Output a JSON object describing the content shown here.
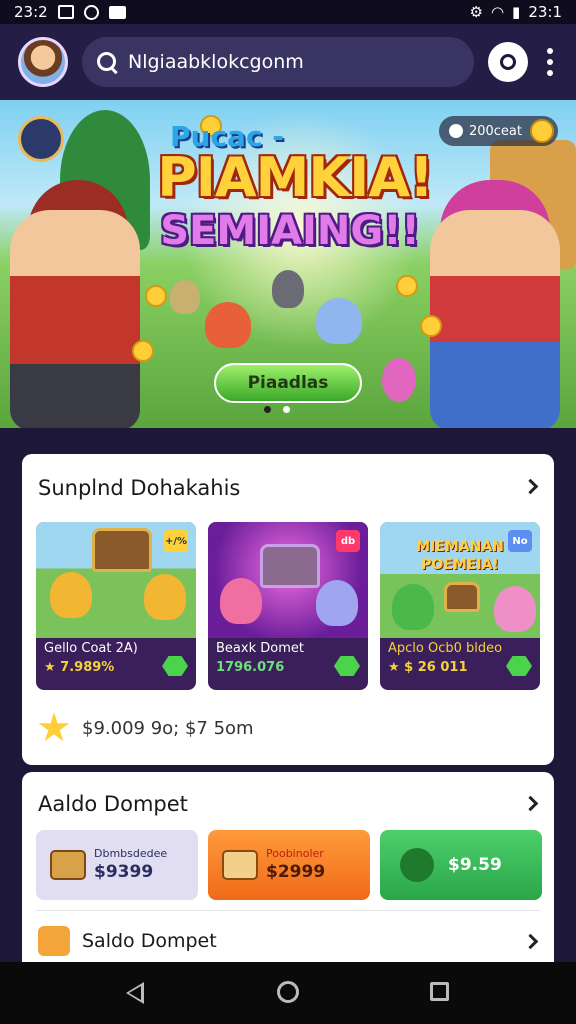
{
  "status_bar": {
    "time": "23:2",
    "right_time": "23:1"
  },
  "search": {
    "text": "Nlgiaabklokcgonm"
  },
  "hero": {
    "top_small": "Pucac -",
    "title": "PIAMKIA!",
    "subtitle": "SEMIAING!!",
    "coin_label": "200ceat",
    "cta": "Piaadlas",
    "page_count": 2,
    "active_page": 2
  },
  "featured": {
    "title": "Sunplnd Dohakahis",
    "tiles": [
      {
        "label": "Gello Coat 2A)",
        "price": "★ 7.989%",
        "tag": "+/%"
      },
      {
        "label": "Beaxk Domet",
        "price": "1796.076",
        "tag": "db"
      },
      {
        "label": "Apclo Ocb0 bldeo",
        "price": "★ $ 26 011",
        "tag": "No",
        "banner": "MIEMANAN POEMEIA!"
      }
    ],
    "promo": "$9.009 9o; $7 5om"
  },
  "wallet": {
    "title": "Aaldo Dompet",
    "cards": [
      {
        "small": "Dbmbsdedee",
        "big": "$9399"
      },
      {
        "small": "Poobinoler",
        "big": "$2999"
      },
      {
        "small": "",
        "big": "$9.59"
      }
    ],
    "row_label": "Saldo Dompet"
  }
}
